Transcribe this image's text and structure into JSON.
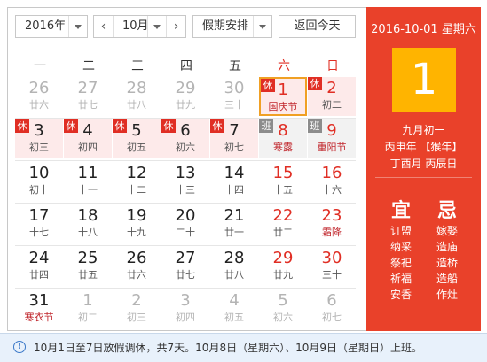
{
  "toolbar": {
    "year_select": "2016年",
    "month_select": "10月",
    "prev_icon": "chevron-left-icon",
    "next_icon": "chevron-right-icon",
    "holiday_select": "假期安排",
    "today_button": "返回今天"
  },
  "weekdays": [
    {
      "label": "一",
      "weekend": false
    },
    {
      "label": "二",
      "weekend": false
    },
    {
      "label": "三",
      "weekend": false
    },
    {
      "label": "四",
      "weekend": false
    },
    {
      "label": "五",
      "weekend": false
    },
    {
      "label": "六",
      "weekend": true
    },
    {
      "label": "日",
      "weekend": true
    }
  ],
  "days": [
    {
      "d": "26",
      "sub": "廿六",
      "other": true
    },
    {
      "d": "27",
      "sub": "廿七",
      "other": true
    },
    {
      "d": "28",
      "sub": "廿八",
      "other": true
    },
    {
      "d": "29",
      "sub": "廿九",
      "other": true
    },
    {
      "d": "30",
      "sub": "三十",
      "other": true
    },
    {
      "d": "1",
      "sub": "国庆节",
      "red": true,
      "tag": "休",
      "holiday": true,
      "today": true,
      "fest": true
    },
    {
      "d": "2",
      "sub": "初二",
      "red": true,
      "tag": "休",
      "holiday": true
    },
    {
      "d": "3",
      "sub": "初三",
      "tag": "休",
      "holiday": true
    },
    {
      "d": "4",
      "sub": "初四",
      "tag": "休",
      "holiday": true
    },
    {
      "d": "5",
      "sub": "初五",
      "tag": "休",
      "holiday": true
    },
    {
      "d": "6",
      "sub": "初六",
      "tag": "休",
      "holiday": true
    },
    {
      "d": "7",
      "sub": "初七",
      "tag": "休",
      "holiday": true
    },
    {
      "d": "8",
      "sub": "寒露",
      "red": true,
      "tag": "班",
      "workday": true,
      "fest": true
    },
    {
      "d": "9",
      "sub": "重阳节",
      "red": true,
      "tag": "班",
      "workday": true,
      "fest": true
    },
    {
      "d": "10",
      "sub": "初十"
    },
    {
      "d": "11",
      "sub": "十一"
    },
    {
      "d": "12",
      "sub": "十二"
    },
    {
      "d": "13",
      "sub": "十三"
    },
    {
      "d": "14",
      "sub": "十四"
    },
    {
      "d": "15",
      "sub": "十五",
      "red": true
    },
    {
      "d": "16",
      "sub": "十六",
      "red": true
    },
    {
      "d": "17",
      "sub": "十七"
    },
    {
      "d": "18",
      "sub": "十八"
    },
    {
      "d": "19",
      "sub": "十九"
    },
    {
      "d": "20",
      "sub": "二十"
    },
    {
      "d": "21",
      "sub": "廿一"
    },
    {
      "d": "22",
      "sub": "廿二",
      "red": true
    },
    {
      "d": "23",
      "sub": "霜降",
      "red": true,
      "fest": true
    },
    {
      "d": "24",
      "sub": "廿四"
    },
    {
      "d": "25",
      "sub": "廿五"
    },
    {
      "d": "26",
      "sub": "廿六"
    },
    {
      "d": "27",
      "sub": "廿七"
    },
    {
      "d": "28",
      "sub": "廿八"
    },
    {
      "d": "29",
      "sub": "廿九",
      "red": true
    },
    {
      "d": "30",
      "sub": "三十",
      "red": true
    },
    {
      "d": "31",
      "sub": "寒衣节",
      "fest": true
    },
    {
      "d": "1",
      "sub": "初二",
      "other": true
    },
    {
      "d": "2",
      "sub": "初三",
      "other": true
    },
    {
      "d": "3",
      "sub": "初四",
      "other": true
    },
    {
      "d": "4",
      "sub": "初五",
      "other": true
    },
    {
      "d": "5",
      "sub": "初六",
      "other": true
    },
    {
      "d": "6",
      "sub": "初七",
      "other": true
    }
  ],
  "side": {
    "date_line": "2016-10-01 星期六",
    "day": "1",
    "lunar": "九月初一",
    "ganzhi_year": "丙申年 【猴年】",
    "ganzhi_month_day": "丁酉月 丙辰日",
    "yi_title": "宜",
    "ji_title": "忌",
    "yi": [
      "订盟",
      "纳采",
      "祭祀",
      "祈福",
      "安香"
    ],
    "ji": [
      "嫁娶",
      "造庙",
      "造桥",
      "造船",
      "作灶"
    ]
  },
  "notice": {
    "icon": "info-icon",
    "text": "10月1日至7日放假调休，共7天。10月8日（星期六）、10月9日（星期日）上班。"
  },
  "colors": {
    "accent_red": "#e9412a",
    "today_border": "#f0a024",
    "day_box": "#ffb400",
    "rest_tag": "#e02e24",
    "work_tag": "#8c8c8c"
  }
}
